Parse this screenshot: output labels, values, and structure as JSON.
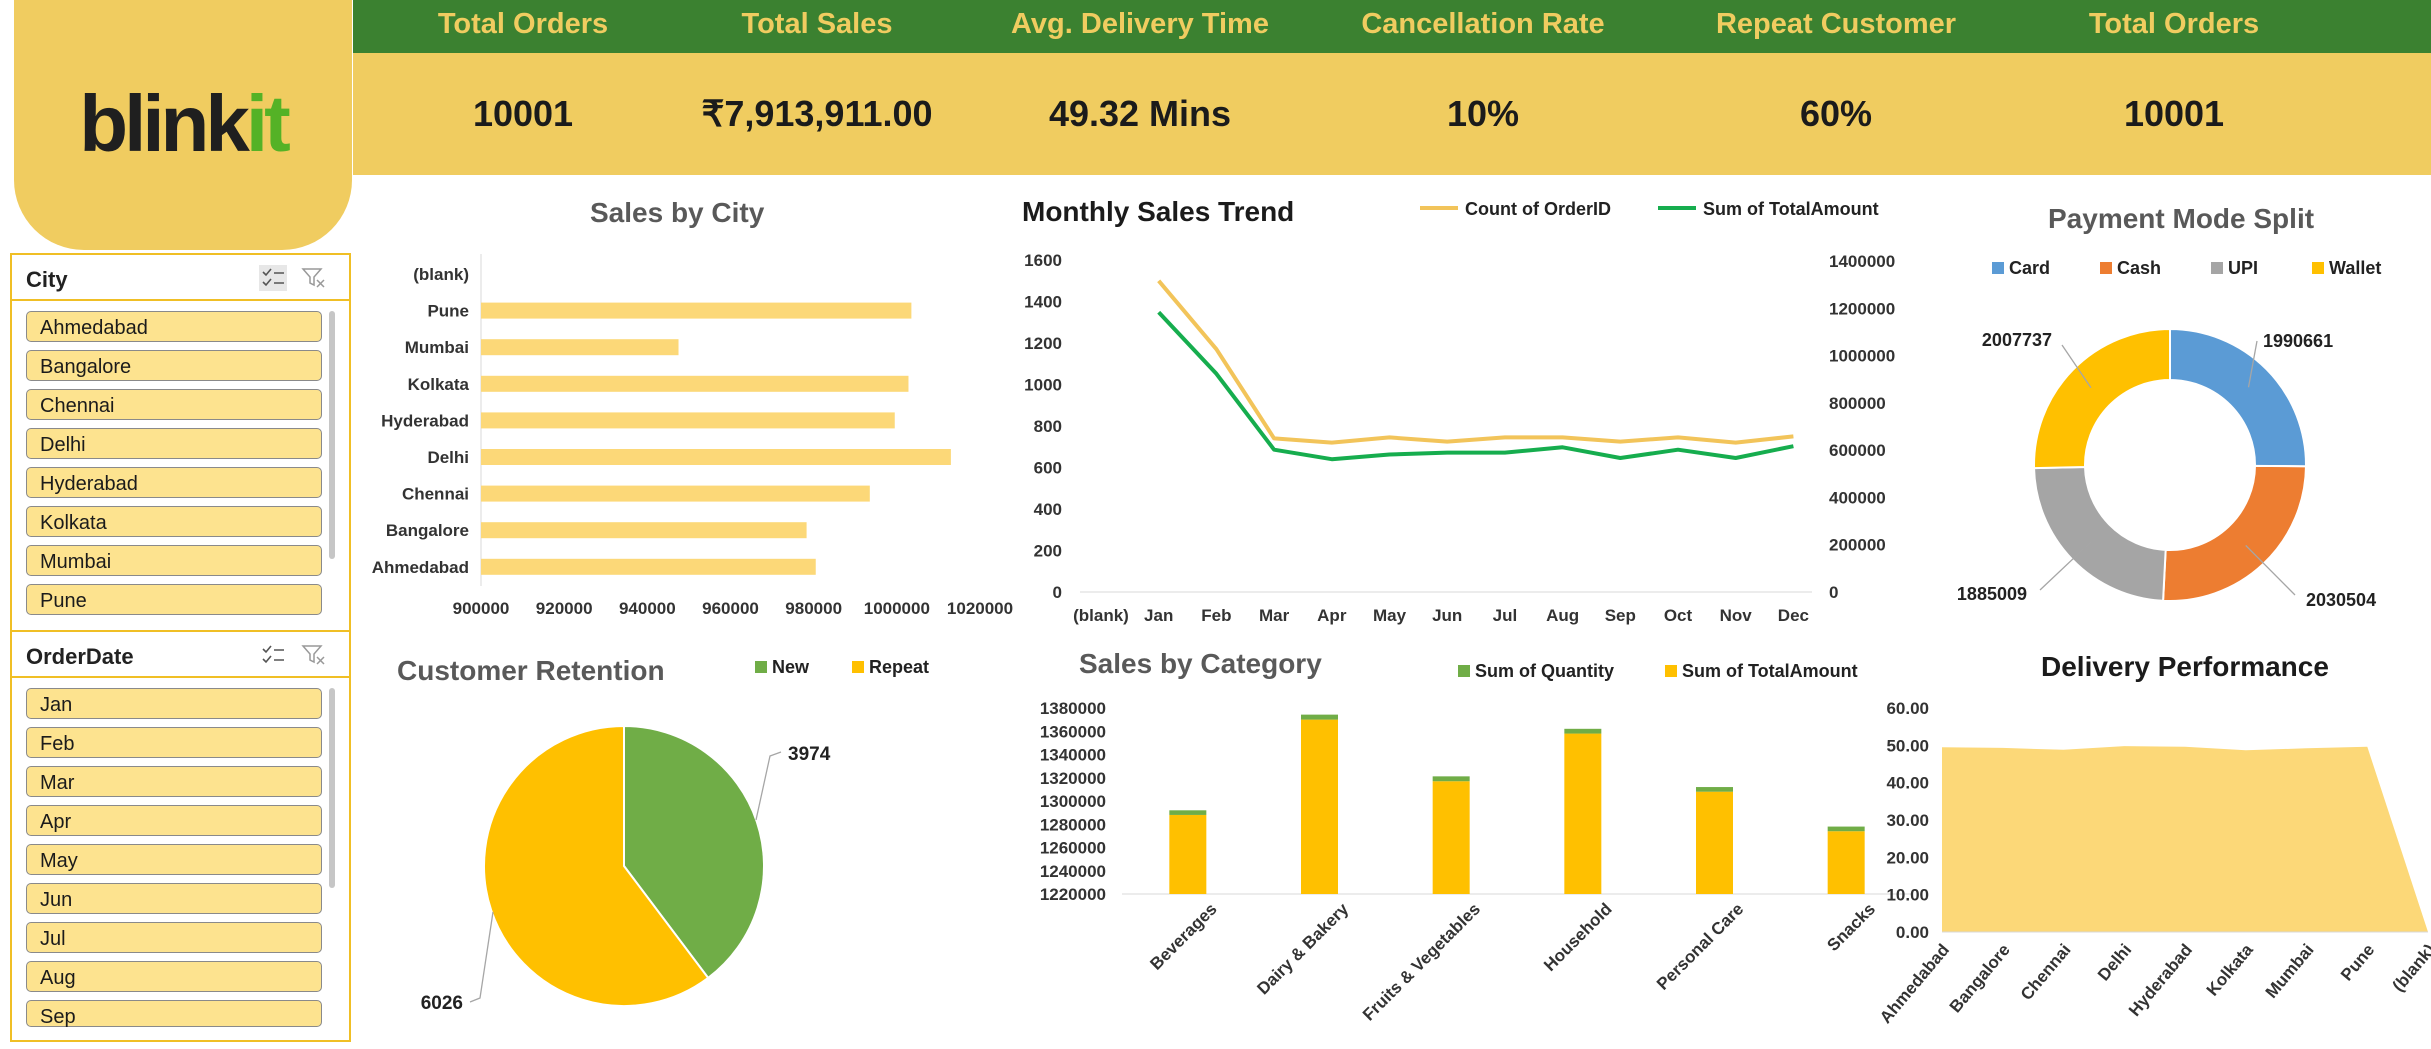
{
  "brand": {
    "logo_main": "blink",
    "logo_accent": "it",
    "accent": "#54b226"
  },
  "colors": {
    "header_green": "#3b8130",
    "header_yellow": "#f0cc60",
    "bar_yellow": "#fcd878",
    "bar_gold": "#ffc000",
    "green": "#70ad47",
    "card_blue": "#5b9bd5",
    "cash_orange": "#ed7d31",
    "upi_grey": "#a5a5a5"
  },
  "kpis": [
    {
      "label": "Total Orders",
      "value": "10001"
    },
    {
      "label": "Total Sales",
      "value": "₹7,913,911.00"
    },
    {
      "label": "Avg. Delivery Time",
      "value": "49.32 Mins"
    },
    {
      "label": "Cancellation Rate",
      "value": "10%"
    },
    {
      "label": "Repeat Customer",
      "value": "60%"
    },
    {
      "label": "Total Orders",
      "value": "10001"
    }
  ],
  "slicers": {
    "city": {
      "title": "City",
      "items": [
        "Ahmedabad",
        "Bangalore",
        "Chennai",
        "Delhi",
        "Hyderabad",
        "Kolkata",
        "Mumbai",
        "Pune"
      ]
    },
    "order_date": {
      "title": "OrderDate",
      "items": [
        "Jan",
        "Feb",
        "Mar",
        "Apr",
        "May",
        "Jun",
        "Jul",
        "Aug",
        "Sep"
      ]
    }
  },
  "chart_data": [
    {
      "id": "sales_by_city",
      "type": "bar",
      "orientation": "horizontal",
      "title": "Sales by City",
      "categories": [
        "(blank)",
        "Pune",
        "Mumbai",
        "Kolkata",
        "Hyderabad",
        "Delhi",
        "Chennai",
        "Bangalore",
        "Ahmedabad"
      ],
      "values": [
        null,
        1003500,
        947500,
        1002800,
        999500,
        1013000,
        993500,
        978300,
        980500
      ],
      "xlim": [
        900000,
        1020000
      ],
      "xticks": [
        "900000",
        "920000",
        "940000",
        "960000",
        "980000",
        "1000000",
        "1020000"
      ]
    },
    {
      "id": "monthly_sales_trend",
      "type": "line",
      "title": "Monthly Sales Trend",
      "categories": [
        "(blank)",
        "Jan",
        "Feb",
        "Mar",
        "Apr",
        "May",
        "Jun",
        "Jul",
        "Aug",
        "Sep",
        "Oct",
        "Nov",
        "Dec"
      ],
      "series": [
        {
          "name": "Count of OrderID",
          "axis": "left",
          "values": [
            null,
            1500,
            1170,
            740,
            720,
            745,
            725,
            745,
            745,
            725,
            745,
            720,
            750
          ]
        },
        {
          "name": "Sum of TotalAmount",
          "axis": "right",
          "values": [
            null,
            1180000,
            920000,
            600000,
            560000,
            580000,
            588000,
            588000,
            610000,
            565000,
            600000,
            565000,
            615000
          ]
        }
      ],
      "ylim_left": [
        0,
        1600
      ],
      "ylim_right": [
        0,
        1400000
      ],
      "yticks_left": [
        "0",
        "200",
        "400",
        "600",
        "800",
        "1000",
        "1200",
        "1400",
        "1600"
      ],
      "yticks_right": [
        "0",
        "200000",
        "400000",
        "600000",
        "800000",
        "1000000",
        "1200000",
        "1400000"
      ],
      "legend": "top-right"
    },
    {
      "id": "payment_mode_split",
      "type": "pie",
      "style": "doughnut",
      "title": "Payment Mode Split",
      "categories": [
        "Card",
        "Cash",
        "UPI",
        "Wallet"
      ],
      "values": [
        1990661,
        2030504,
        1885009,
        2007737
      ],
      "labels": [
        "1990661",
        "2030504",
        "1885009",
        "2007737"
      ],
      "legend": "top"
    },
    {
      "id": "customer_retention",
      "type": "pie",
      "title": "Customer Retention",
      "categories": [
        "New",
        "Repeat"
      ],
      "values": [
        3974,
        6026
      ],
      "labels": [
        "3974",
        "6026"
      ],
      "legend": "top-right"
    },
    {
      "id": "sales_by_category",
      "type": "bar",
      "stacked": true,
      "title": "Sales by Category",
      "categories": [
        "Beverages",
        "Dairy & Bakery",
        "Fruits & Vegetables",
        "Household",
        "Personal Care",
        "Snacks"
      ],
      "series": [
        {
          "name": "Sum of Quantity",
          "values": [
            4000,
            4300,
            4200,
            4100,
            4000,
            4000
          ]
        },
        {
          "name": "Sum of TotalAmount",
          "values": [
            1288000,
            1370000,
            1317000,
            1358000,
            1308000,
            1274000
          ]
        }
      ],
      "ylim": [
        1220000,
        1380000
      ],
      "yticks": [
        "1220000",
        "1240000",
        "1260000",
        "1280000",
        "1300000",
        "1320000",
        "1340000",
        "1360000",
        "1380000"
      ],
      "legend": "top-right"
    },
    {
      "id": "delivery_performance",
      "type": "area",
      "title": "Delivery Performance",
      "categories": [
        "Ahmedabad",
        "Bangalore",
        "Chennai",
        "Delhi",
        "Hyderabad",
        "Kolkata",
        "Mumbai",
        "Pune",
        "(blank)"
      ],
      "values": [
        49.5,
        49.3,
        48.8,
        49.8,
        49.6,
        48.7,
        49.2,
        49.6,
        0
      ],
      "ylim": [
        0,
        60
      ],
      "yticks": [
        "0.00",
        "10.00",
        "20.00",
        "30.00",
        "40.00",
        "50.00",
        "60.00"
      ]
    }
  ]
}
